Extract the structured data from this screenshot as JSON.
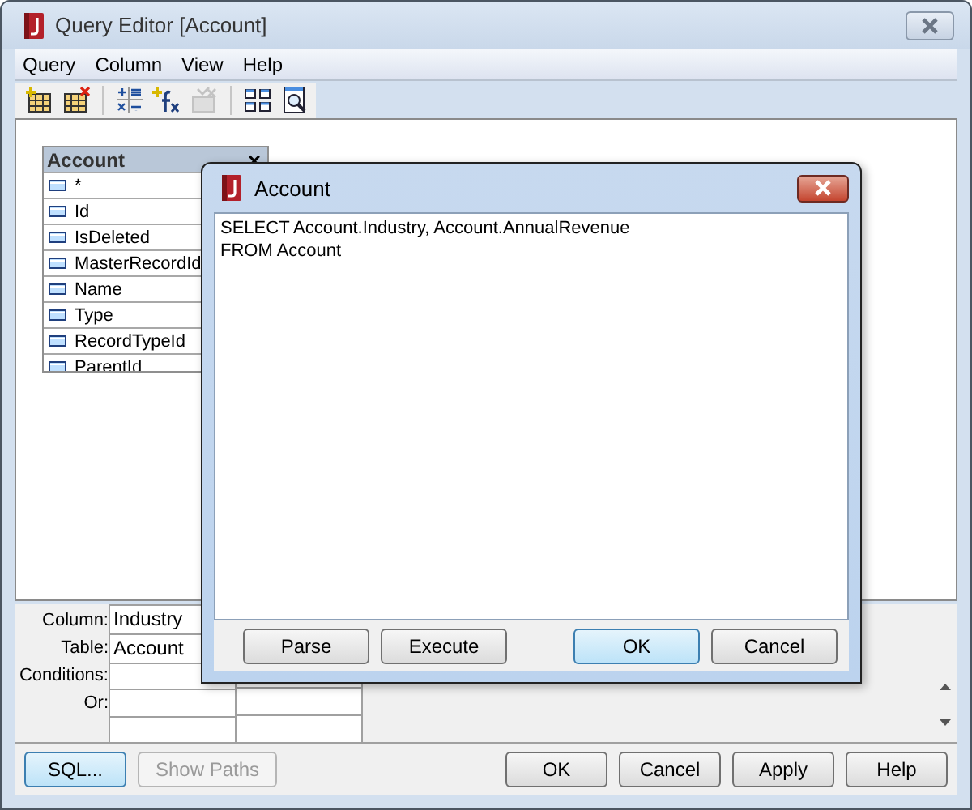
{
  "window": {
    "title": "Query Editor [Account]"
  },
  "menu": [
    "Query",
    "Column",
    "View",
    "Help"
  ],
  "toolbar": [
    {
      "kind": "add-table"
    },
    {
      "kind": "remove-table"
    },
    {
      "kind": "separator"
    },
    {
      "kind": "calculator"
    },
    {
      "kind": "function"
    },
    {
      "kind": "clear",
      "disabled": true
    },
    {
      "kind": "separator"
    },
    {
      "kind": "layout"
    },
    {
      "kind": "preview"
    }
  ],
  "table_card": {
    "title": "Account",
    "close": "×",
    "fields": [
      "*",
      "Id",
      "IsDeleted",
      "MasterRecordId",
      "Name",
      "Type",
      "RecordTypeId",
      "ParentId"
    ]
  },
  "query_grid": {
    "labels": [
      "Column:",
      "Table:",
      "Conditions:",
      "Or:"
    ],
    "columns": [
      {
        "column": "Industry",
        "table": "Account"
      }
    ]
  },
  "left_buttons": [
    {
      "label": "SQL...",
      "default": true,
      "disabled": false
    },
    {
      "label": "Show Paths",
      "default": false,
      "disabled": true
    }
  ],
  "right_buttons": [
    {
      "label": "OK",
      "default": false,
      "disabled": false
    },
    {
      "label": "Cancel",
      "default": false,
      "disabled": false
    },
    {
      "label": "Apply",
      "default": false,
      "disabled": false
    },
    {
      "label": "Help",
      "default": false,
      "disabled": false
    }
  ],
  "dialog": {
    "title": "Account",
    "sql": [
      "SELECT Account.Industry, Account.AnnualRevenue",
      "FROM Account"
    ],
    "buttons": [
      {
        "label": "Parse",
        "default": false
      },
      {
        "label": "Execute",
        "default": false
      },
      {
        "label": "OK",
        "default": true
      },
      {
        "label": "Cancel",
        "default": false
      }
    ]
  }
}
